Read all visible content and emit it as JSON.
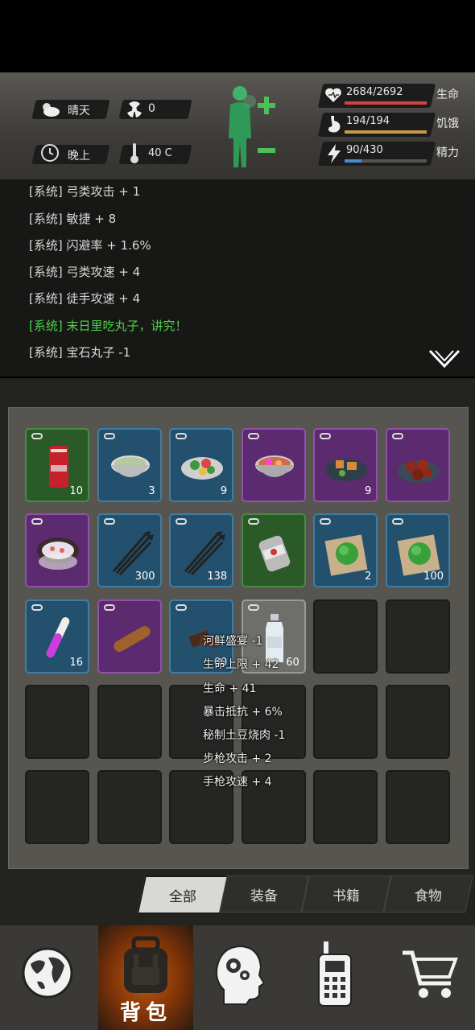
{
  "status": {
    "weather": "晴天",
    "radiation": "0",
    "time_of_day": "晚上",
    "temperature": "40 C",
    "health": {
      "value": "2684/2692",
      "label": "生命",
      "ratio": 0.997,
      "color": "#d94040"
    },
    "hunger": {
      "value": "194/194",
      "label": "饥饿",
      "ratio": 1.0,
      "color": "#c99a4a"
    },
    "energy": {
      "value": "90/430",
      "label": "精力",
      "ratio": 0.209,
      "color": "#4a8ad4"
    }
  },
  "log": {
    "lines": [
      {
        "text": "[系统] 弓类攻击 + 1",
        "style": "normal"
      },
      {
        "text": "[系统] 敏捷 + 8",
        "style": "normal"
      },
      {
        "text": "[系统] 闪避率 + 1.6%",
        "style": "normal"
      },
      {
        "text": "[系统] 弓类攻速 + 4",
        "style": "normal"
      },
      {
        "text": "[系统] 徒手攻速 + 4",
        "style": "normal"
      },
      {
        "text": "[系统] 末日里吃丸子，讲究！",
        "style": "green"
      },
      {
        "text": "[系统] 宝石丸子 -1",
        "style": "normal"
      }
    ]
  },
  "inventory": {
    "slots": [
      {
        "rarity": "green",
        "icon": "beer-can-icon",
        "count": "10"
      },
      {
        "rarity": "blue",
        "icon": "porridge-bowl-icon",
        "count": "3"
      },
      {
        "rarity": "blue",
        "icon": "salad-plate-icon",
        "count": "9"
      },
      {
        "rarity": "purple",
        "icon": "seafood-bowl-icon",
        "count": ""
      },
      {
        "rarity": "purple",
        "icon": "roasted-dish-icon",
        "count": "9"
      },
      {
        "rarity": "purple",
        "icon": "meatballs-plate-icon",
        "count": ""
      },
      {
        "rarity": "purple",
        "icon": "rice-pot-icon",
        "count": ""
      },
      {
        "rarity": "blue",
        "icon": "arrows-bundle-icon",
        "count": "300"
      },
      {
        "rarity": "blue",
        "icon": "arrows-bundle-icon",
        "count": "138"
      },
      {
        "rarity": "green",
        "icon": "canned-food-icon",
        "count": ""
      },
      {
        "rarity": "blue",
        "icon": "vegetable-cloth-icon",
        "count": "2"
      },
      {
        "rarity": "blue",
        "icon": "vegetable-cloth-icon",
        "count": "100"
      },
      {
        "rarity": "blue",
        "icon": "potion-tube-icon",
        "count": "16"
      },
      {
        "rarity": "purple",
        "icon": "sausage-icon",
        "count": ""
      },
      {
        "rarity": "blue",
        "icon": "chocolate-icon",
        "count": "60"
      },
      {
        "rarity": "gray",
        "icon": "water-bottle-icon",
        "count": "60"
      },
      {
        "rarity": "empty",
        "icon": "",
        "count": ""
      },
      {
        "rarity": "empty",
        "icon": "",
        "count": ""
      }
    ],
    "empty_rows": 2
  },
  "tooltip": {
    "lines": [
      "河鲜盛宴 -1",
      "生命上限 + 42",
      "生命 + 41",
      "暴击抵抗 + 6%",
      "秘制土豆烧肉 -1",
      "步枪攻击 + 2",
      "手枪攻速 + 4"
    ]
  },
  "tabs": [
    {
      "label": "全部",
      "active": true
    },
    {
      "label": "装备",
      "active": false
    },
    {
      "label": "书籍",
      "active": false
    },
    {
      "label": "食物",
      "active": false
    }
  ],
  "nav": [
    {
      "name": "world",
      "icon": "globe-icon",
      "label": ""
    },
    {
      "name": "backpack",
      "icon": "backpack-icon",
      "label": "背包"
    },
    {
      "name": "skills",
      "icon": "head-gears-icon",
      "label": ""
    },
    {
      "name": "radio",
      "icon": "walkie-talkie-icon",
      "label": ""
    },
    {
      "name": "shop",
      "icon": "shopping-cart-icon",
      "label": ""
    }
  ]
}
